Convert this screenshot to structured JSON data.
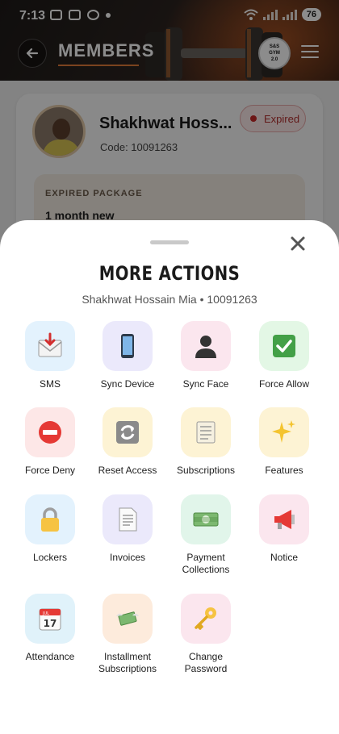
{
  "status_bar": {
    "time": "7:13",
    "battery": "76"
  },
  "header": {
    "title": "MEMBERS",
    "logo_line1": "S&S",
    "logo_line2": "GYM",
    "logo_line3": "2.0"
  },
  "member": {
    "name": "Shakhwat Hoss...",
    "code": "Code: 10091263",
    "status": "Expired",
    "package_label": "EXPIRED PACKAGE",
    "package_name": "1 month new"
  },
  "sheet": {
    "title": "MORE ACTIONS",
    "subtitle": "Shakhwat Hossain Mia • 10091263",
    "actions": [
      {
        "label": "SMS",
        "icon": "envelope-icon"
      },
      {
        "label": "Sync Device",
        "icon": "phone-icon"
      },
      {
        "label": "Sync Face",
        "icon": "person-icon"
      },
      {
        "label": "Force Allow",
        "icon": "check-icon"
      },
      {
        "label": "Force Deny",
        "icon": "no-entry-icon"
      },
      {
        "label": "Reset Access",
        "icon": "refresh-icon"
      },
      {
        "label": "Subscriptions",
        "icon": "scroll-icon"
      },
      {
        "label": "Features",
        "icon": "sparkles-icon"
      },
      {
        "label": "Lockers",
        "icon": "lock-icon"
      },
      {
        "label": "Invoices",
        "icon": "document-icon"
      },
      {
        "label": "Payment Collections",
        "icon": "cash-icon"
      },
      {
        "label": "Notice",
        "icon": "megaphone-icon"
      },
      {
        "label": "Attendance",
        "icon": "calendar-icon"
      },
      {
        "label": "Installment Subscriptions",
        "icon": "money-wings-icon"
      },
      {
        "label": "Change Password",
        "icon": "key-icon"
      }
    ],
    "calendar_day": "17",
    "calendar_month": "JUL"
  }
}
